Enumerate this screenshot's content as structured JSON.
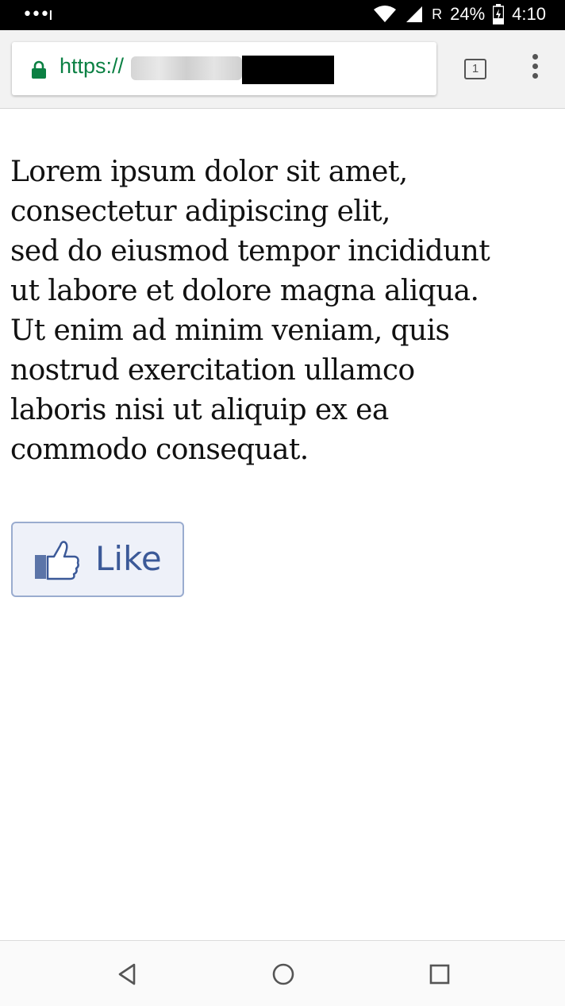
{
  "status_bar": {
    "notification_dots": "•••ı",
    "roaming": "R",
    "battery": "24%",
    "time": "4:10"
  },
  "browser": {
    "url_scheme": "https://",
    "tab_count": "1"
  },
  "content": {
    "paragraph": "Lorem ipsum dolor sit amet,\nconsectetur adipiscing elit,\nsed do eiusmod tempor incididunt\nut labore et dolore magna aliqua.\nUt enim ad minim veniam, quis\nnostrud exercitation ullamco\nlaboris nisi ut aliquip ex ea\ncommodo consequat.",
    "like_label": "Like"
  },
  "colors": {
    "url_green": "#0b8043",
    "like_text": "#3b5998",
    "like_border": "#9aaccf",
    "like_bg": "#eef1f9"
  }
}
